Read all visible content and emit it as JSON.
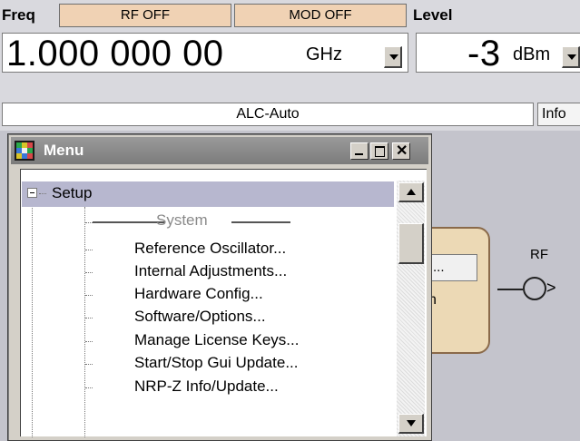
{
  "header": {
    "freq_label": "Freq",
    "rf_toggle": "RF OFF",
    "mod_toggle": "MOD OFF",
    "level_label": "Level"
  },
  "frequency": {
    "value": "1.000 000 00",
    "unit": "GHz"
  },
  "level": {
    "value": "-3",
    "unit": "dBm"
  },
  "status": {
    "alc": "ALC-Auto",
    "info_button": "Info"
  },
  "diagram": {
    "block_button": "...",
    "block_text": "n",
    "rf_output_label": "RF"
  },
  "menu": {
    "title": "Menu",
    "tree_root": "Setup",
    "section_label": "System",
    "items": [
      {
        "label": "Reference Oscillator..."
      },
      {
        "label": "Internal Adjustments..."
      },
      {
        "label": "Hardware Config..."
      },
      {
        "label": "Software/Options..."
      },
      {
        "label": "Manage License Keys..."
      },
      {
        "label": "Start/Stop Gui Update..."
      },
      {
        "label": "NRP-Z Info/Update..."
      }
    ]
  },
  "colors": {
    "toggle_button_bg": "#f0d2b4",
    "selected_row_bg": "#b7b7cf",
    "window_bg": "#d4d0c8",
    "block_bg": "#ecd9b5"
  },
  "icons": [
    "app-menu-icon",
    "minimize-icon",
    "maximize-icon",
    "close-icon",
    "expander-minus-icon",
    "scroll-up-icon",
    "scroll-down-icon",
    "dropdown-arrow-icon",
    "rf-output-icon"
  ]
}
